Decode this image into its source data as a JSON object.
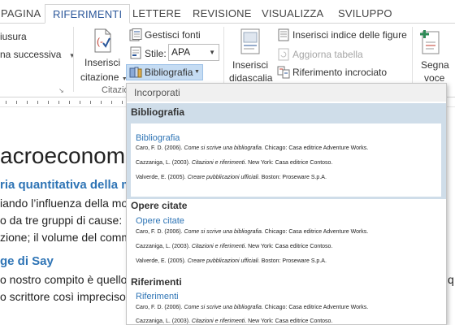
{
  "tabs": [
    {
      "label": "PAGINA"
    },
    {
      "label": "RIFERIMENTI"
    },
    {
      "label": "LETTERE"
    },
    {
      "label": "REVISIONE"
    },
    {
      "label": "VISUALIZZA"
    },
    {
      "label": "SVILUPPO"
    }
  ],
  "ribbon": {
    "footnotes": {
      "line1": "iusura",
      "line2": "na successiva"
    },
    "citation": {
      "insert_label_1": "Inserisci",
      "insert_label_2": "citazione",
      "group_label": "Citazio",
      "manage_sources": "Gestisci fonti",
      "style_label": "Stile:",
      "style_value": "APA",
      "bibliography": "Bibliografia"
    },
    "captions": {
      "insert_label_1": "Inserisci",
      "insert_label_2": "didascalia",
      "insert_figures_index": "Inserisci indice delle figure",
      "update_table": "Aggiorna tabella",
      "cross_reference": "Riferimento incrociato"
    },
    "index": {
      "line1": "Segna",
      "line2": "voce"
    }
  },
  "document": {
    "heading1": "acroeconom",
    "heading2a": "ria quantitativa della m",
    "para1_line1": "iando l’influenza della mor",
    "para1_line2": "o da tre gruppi di cause: la",
    "para1_line3": "zione; il volume del comme",
    "heading2b": "ge di Say",
    "para2_line1": "o nostro compito è quello c",
    "para2_line2": "o scrittore così impreciso, n",
    "right_edge_char": "q"
  },
  "dropdown": {
    "header": "Incorporati",
    "sections": [
      {
        "title": "Bibliografia",
        "card_title": "Bibliografia",
        "entries": [
          {
            "author": "Caro, F. D. (2006). ",
            "title": "Come si scrive una bibliografia",
            "rest": ". Chicago: Casa editrice Adventure Works."
          },
          {
            "author": "Cazzaniga, L. (2003). ",
            "title": "Citazioni e riferimenti",
            "rest": ". New York: Casa editrice Contoso."
          },
          {
            "author": "Valverde, E. (2005). ",
            "title": "Creare pubblicazioni ufficiali",
            "rest": ". Boston: Proseware S.p.A."
          }
        ]
      },
      {
        "title": "Opere citate",
        "card_title": "Opere citate",
        "entries": [
          {
            "author": "Caro, F. D. (2006). ",
            "title": "Come si scrive una bibliografia",
            "rest": ". Chicago: Casa editrice Adventure Works."
          },
          {
            "author": "Cazzaniga, L. (2003). ",
            "title": "Citazioni e riferimenti",
            "rest": ". New York: Casa editrice Contoso."
          },
          {
            "author": "Valverde, E. (2005). ",
            "title": "Creare pubblicazioni ufficiali",
            "rest": ". Boston: Proseware S.p.A."
          }
        ]
      },
      {
        "title": "Riferimenti",
        "card_title": "Riferimenti",
        "entries": [
          {
            "author": "Caro, F. D. (2006). ",
            "title": "Come si scrive una bibliografia",
            "rest": ". Chicago: Casa editrice Adventure Works."
          },
          {
            "author": "Cazzaniga, L. (2003). ",
            "title": "Citazioni e riferimenti",
            "rest": ". New York: Casa editrice Contoso."
          }
        ]
      }
    ]
  },
  "colors": {
    "accent": "#2b579a",
    "heading_blue": "#2e74b5",
    "highlight": "#cfdde9",
    "button_active": "#c5dcf3"
  }
}
